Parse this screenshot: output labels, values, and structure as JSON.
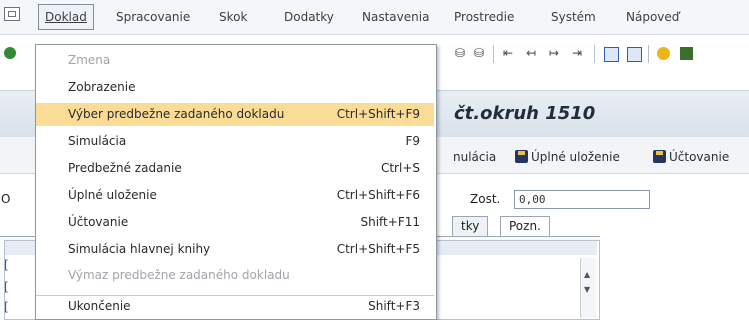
{
  "menubar": {
    "items": [
      "Doklad",
      "Spracovanie",
      "Skok",
      "Dodatky",
      "Nastavenia",
      "Prostredie",
      "Systém",
      "Nápoveď"
    ],
    "active": "Doklad"
  },
  "page": {
    "title": "čt.okruh 1510"
  },
  "app_toolbar": {
    "simulate_partial": "nulácia",
    "full_save": "Úplné uloženie",
    "post": "Účtovanie"
  },
  "form": {
    "left_label": "O",
    "zost_label": "Zost.",
    "zost_value": "0,00"
  },
  "tabs": [
    "tky",
    "Pozn."
  ],
  "left_clip_chars": [
    "[",
    "[",
    "["
  ],
  "dropdown": {
    "items": [
      {
        "label": "Zmena",
        "shortcut": "",
        "state": "disabled"
      },
      {
        "label": "Zobrazenie",
        "shortcut": "",
        "state": "normal"
      },
      {
        "label": "Výber predbežne zadaného dokladu",
        "shortcut": "Ctrl+Shift+F9",
        "state": "selected"
      },
      {
        "label": "Simulácia",
        "shortcut": "F9",
        "state": "normal"
      },
      {
        "label": "Predbežné zadanie",
        "shortcut": "Ctrl+S",
        "state": "normal"
      },
      {
        "label": "Úplné uloženie",
        "shortcut": "Ctrl+Shift+F6",
        "state": "normal"
      },
      {
        "label": "Účtovanie",
        "shortcut": "Shift+F11",
        "state": "normal"
      },
      {
        "label": "Simulácia hlavnej knihy",
        "shortcut": "Ctrl+Shift+F5",
        "state": "normal"
      },
      {
        "label": "Výmaz predbežne zadaného dokladu",
        "shortcut": "",
        "state": "disabled"
      },
      {
        "label": "Ukončenie",
        "shortcut": "Shift+F3",
        "state": "normal"
      }
    ]
  },
  "colors": {
    "highlight": "#fbdc96",
    "disabled_text": "#a0a4aa",
    "title_text": "#1f2d3d"
  }
}
